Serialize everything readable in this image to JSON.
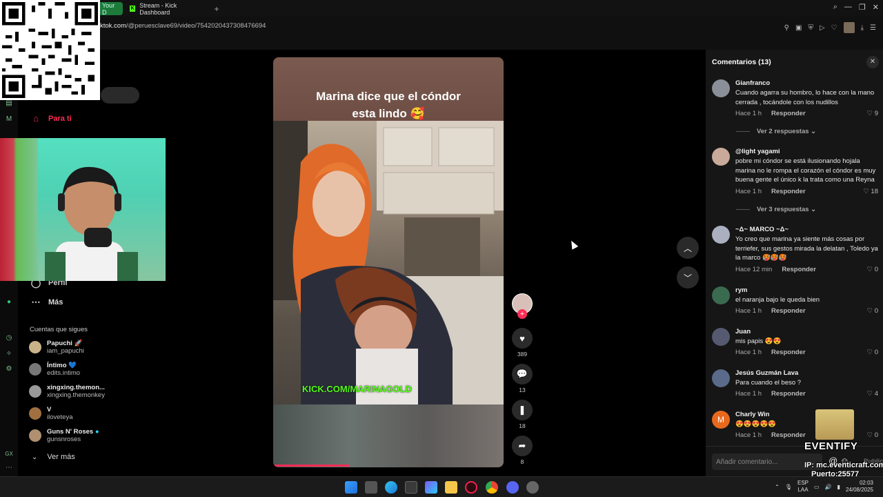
{
  "browser": {
    "tabs": [
      {
        "label": "Your D",
        "active": true
      },
      {
        "label": "Stream - Kick Dashboard",
        "active": false
      }
    ],
    "new_tab": "+",
    "url_host": "ktok.com",
    "url_path": "/@peruesclave69/video/7542020437308476694"
  },
  "left_nav": {
    "items": [
      {
        "label": "Para ti",
        "icon": "home-icon",
        "active": true
      },
      {
        "label": "Perfil",
        "icon": "profile-icon"
      },
      {
        "label": "Más",
        "icon": "more-icon"
      }
    ],
    "follows_title": "Cuentas que sigues",
    "follows": [
      {
        "name": "Papuchi 🚀",
        "user": "iam_papuchi"
      },
      {
        "name": "Íntimo 💙",
        "user": "edits.intimo"
      },
      {
        "name": "xingxing.themon...",
        "user": "xingxing.themonkey"
      },
      {
        "name": "V",
        "user": "iloveteya"
      },
      {
        "name": "Guns N' Roses",
        "user": "gunsnroses",
        "verified": true
      }
    ],
    "see_more": "Ver más"
  },
  "video": {
    "caption_line1": "Marina dice que el cóndor",
    "caption_line2": "esta lindo 🥰",
    "watermark": "KICK.COM/MARINAGOLD",
    "progress": 0.33
  },
  "actions": {
    "likes": "389",
    "comments": "13",
    "saves": "18",
    "shares": "8",
    "follow_plus": "+"
  },
  "comments": {
    "title": "Comentarios (13)",
    "items": [
      {
        "user": "Gianfranco",
        "text": "Cuando agarra su hombro, lo hace con la mano cerrada , tocándole con los nudillos",
        "time": "Hace 1 h",
        "reply": "Responder",
        "likes": "9",
        "replies": "Ver 2 respuestas"
      },
      {
        "user": "@light yagami",
        "text": "pobre mi cóndor se está ilusionando hojala marina no le rompa el corazón el cóndor es muy buena gente el único k la trata como una Reyna",
        "time": "Hace 1 h",
        "reply": "Responder",
        "likes": "18",
        "replies": "Ver 3 respuestas"
      },
      {
        "user": "~Δ~ MARCO ~Δ~",
        "text": "Yo creo que marina ya siente más cosas por terriefer, sus gestos mirada la delatan , Toledo ya la marco 🥵🥵🥵",
        "time": "Hace 12 min",
        "reply": "Responder",
        "likes": "0"
      },
      {
        "user": "rym",
        "text": "el naranja bajo le queda bien",
        "time": "Hace 1 h",
        "reply": "Responder",
        "likes": "0"
      },
      {
        "user": "Juan",
        "text": "mis papis 😍😍",
        "time": "Hace 1 h",
        "reply": "Responder",
        "likes": "0"
      },
      {
        "user": "Jesús Guzmán Lava",
        "text": "Para cuando el beso ?",
        "time": "Hace 1 h",
        "reply": "Responder",
        "likes": "4"
      },
      {
        "user": "Charly Win",
        "avatar_letter": "M",
        "text": "😍😍😍😍😍",
        "time": "Hace 1 h",
        "reply": "Responder",
        "likes": "0"
      }
    ],
    "input_placeholder": "Añadir comentario...",
    "publish": "Publicar"
  },
  "overlay": {
    "brand": "EVENTIFY",
    "ip": "IP: mc.eventicraft.com",
    "port": "Puerto:25577"
  },
  "taskbar": {
    "lang_line1": "ESP",
    "lang_line2": "LAA",
    "time": "02:03",
    "date": "24/08/2025"
  },
  "colors": {
    "tiktok_red": "#fe2c55",
    "kick_green": "#53fc18",
    "panel_bg": "#161616"
  }
}
